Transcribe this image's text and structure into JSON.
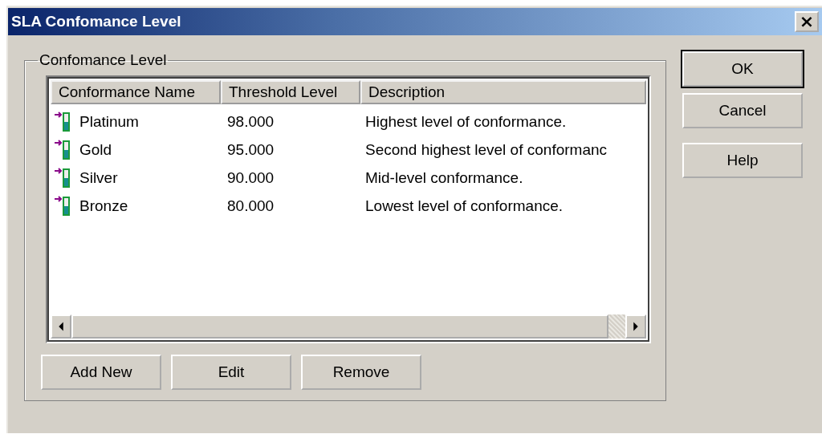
{
  "window": {
    "title": "SLA Confomance Level",
    "close": "×"
  },
  "group": {
    "label": "Confomance Level"
  },
  "table": {
    "columns": [
      "Conformance Name",
      "Threshold Level",
      "Description"
    ],
    "rows": [
      {
        "name": "Platinum",
        "threshold": "98.000",
        "description": "Highest level of conformance."
      },
      {
        "name": "Gold",
        "threshold": "95.000",
        "description": "Second highest level of conformanc"
      },
      {
        "name": "Silver",
        "threshold": "90.000",
        "description": "Mid-level conformance."
      },
      {
        "name": "Bronze",
        "threshold": "80.000",
        "description": "Lowest level of conformance."
      }
    ]
  },
  "list_buttons": [
    "Add New",
    "Edit",
    "Remove"
  ],
  "dialog_buttons": [
    {
      "label": "OK",
      "default": true
    },
    {
      "label": "Cancel",
      "default": false
    },
    {
      "label": "Help",
      "default": false
    }
  ]
}
